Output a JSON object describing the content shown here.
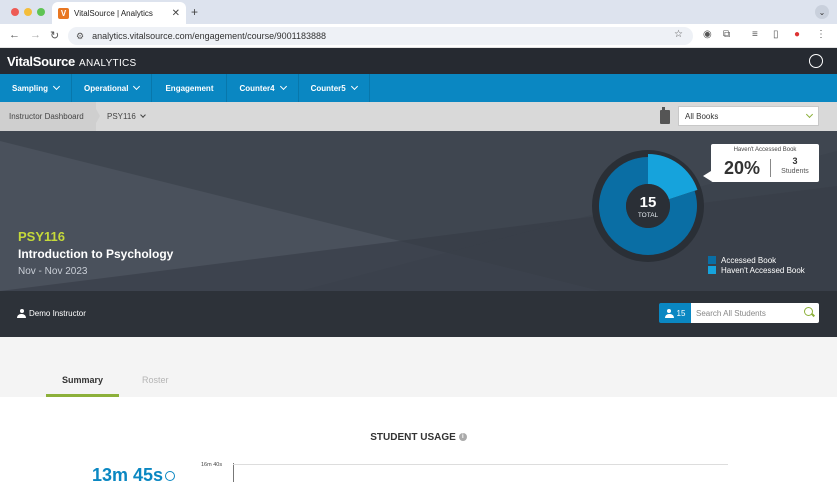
{
  "browser": {
    "tab_title": "VitalSource | Analytics",
    "favicon_letter": "V",
    "url": "analytics.vitalsource.com/engagement/course/9001183888"
  },
  "header": {
    "brand": "VitalSource",
    "brand_sub": "ANALYTICS"
  },
  "nav": {
    "items": [
      {
        "label": "Sampling",
        "has_dropdown": true
      },
      {
        "label": "Operational",
        "has_dropdown": true
      },
      {
        "label": "Engagement",
        "has_dropdown": false
      },
      {
        "label": "Counter4",
        "has_dropdown": true
      },
      {
        "label": "Counter5",
        "has_dropdown": true
      }
    ]
  },
  "breadcrumb": {
    "home": "Instructor Dashboard",
    "course": "PSY116"
  },
  "books_select": {
    "value": "All Books"
  },
  "course": {
    "code": "PSY116",
    "title": "Introduction to Psychology",
    "dates": "Nov - Nov 2023"
  },
  "donut": {
    "total": "15",
    "total_label": "TOTAL",
    "accessed_fraction": 0.8,
    "not_accessed_fraction": 0.2,
    "callout_title": "Haven't Accessed Book",
    "callout_pct": "20%",
    "callout_count": "3",
    "callout_unit": "Students",
    "colors": {
      "accessed": "#0a6ea4",
      "not_accessed": "#16a3dc",
      "ring": "#2a2f36"
    }
  },
  "legend": {
    "accessed": "Accessed Book",
    "not_accessed": "Haven't Accessed Book"
  },
  "instructor": {
    "name": "Demo Instructor",
    "student_count": "15",
    "search_placeholder": "Search All Students"
  },
  "page_tabs": {
    "summary": "Summary",
    "roster": "Roster"
  },
  "usage": {
    "title": "STUDENT USAGE",
    "big_value": "13m 45s",
    "axis_top": "16m 40s"
  }
}
